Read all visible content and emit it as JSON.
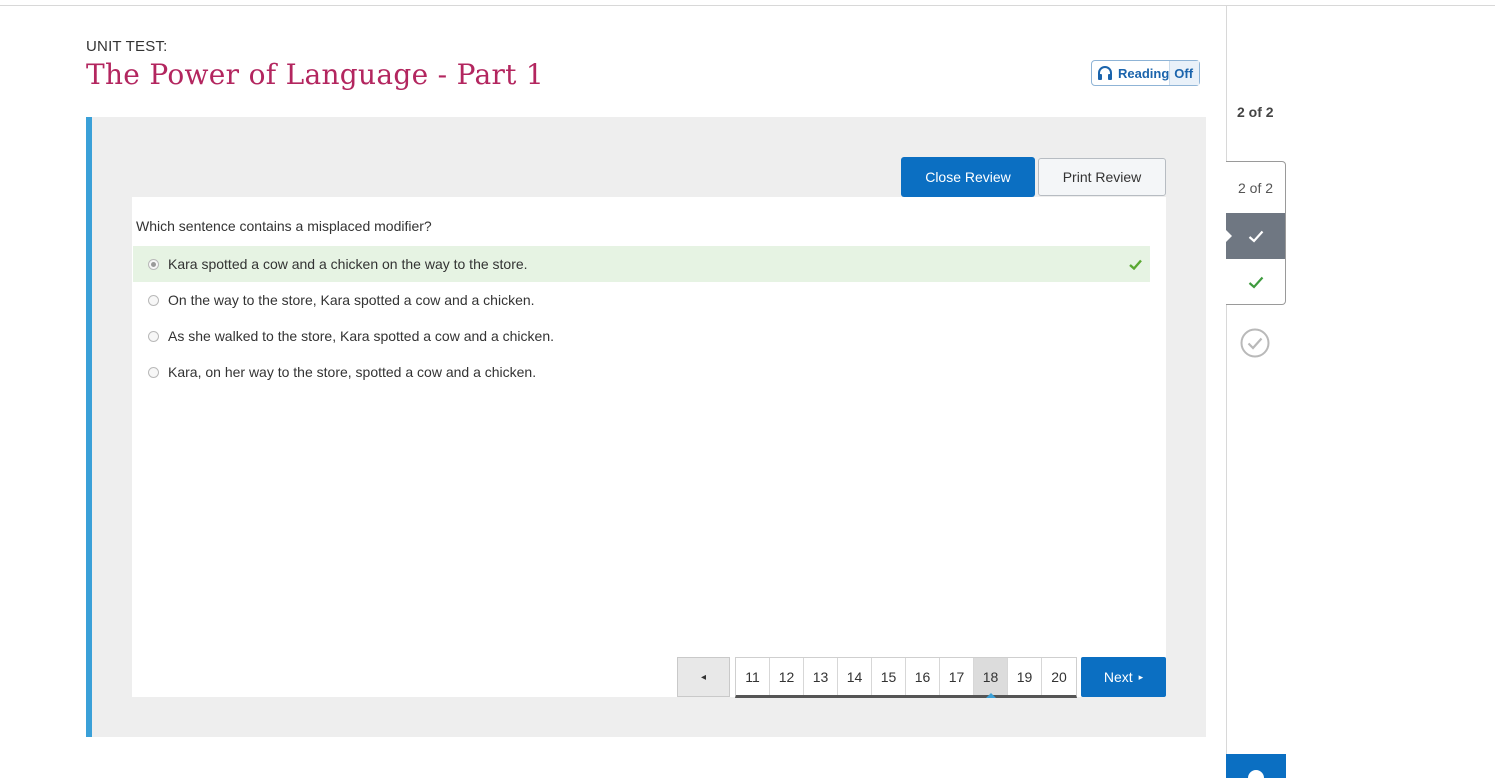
{
  "header": {
    "unit_label": "UNIT TEST:",
    "title": "The Power of Language - Part 1"
  },
  "reading_toggle": {
    "label": "Reading",
    "state": "Off",
    "icon": "headphones-icon"
  },
  "review": {
    "close_label": "Close Review",
    "print_label": "Print Review"
  },
  "question": {
    "text": "Which sentence contains a misplaced modifier?",
    "choices": [
      {
        "label": "Kara spotted a cow and a chicken on the way to the store.",
        "selected": true,
        "correct": true
      },
      {
        "label": "On the way to the store, Kara spotted a cow and a chicken.",
        "selected": false
      },
      {
        "label": "As she walked to the store, Kara spotted a cow and a chicken.",
        "selected": false
      },
      {
        "label": "Kara, on her way to the store, spotted a cow and a chicken.",
        "selected": false
      }
    ]
  },
  "pager": {
    "prev_symbol": "◂",
    "pages": [
      "11",
      "12",
      "13",
      "14",
      "15",
      "16",
      "17",
      "18",
      "19",
      "20"
    ],
    "current": "18",
    "next_label": "Next",
    "next_symbol": "▸"
  },
  "sidebar": {
    "count_label": "2 of 2",
    "box_label": "2 of 2"
  },
  "colors": {
    "title": "#b3265f",
    "primary": "#0b6fc2",
    "accent": "#3aa0d8",
    "correct": "#5aa832",
    "selected_bg": "#e6f3e3"
  }
}
